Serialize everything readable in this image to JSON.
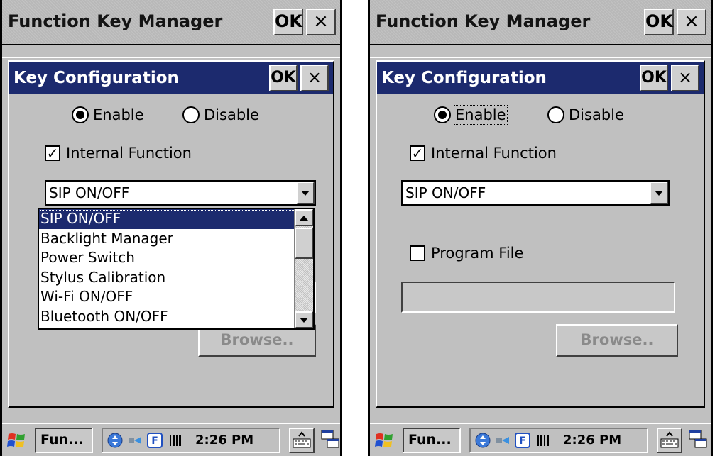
{
  "left": {
    "app_title": "Function Key Manager",
    "ok_label": "OK",
    "close_label": "×",
    "dialog": {
      "title": "Key Configuration",
      "ok_label": "OK",
      "close_label": "×",
      "enable_label": "Enable",
      "disable_label": "Disable",
      "enable_selected": true,
      "internal_function_label": "Internal Function",
      "internal_function_checked": true,
      "combo_value": "SIP ON/OFF",
      "dropdown_items": [
        "SIP ON/OFF",
        "Backlight Manager",
        "Power Switch",
        "Stylus Calibration",
        "Wi-Fi ON/OFF",
        "Bluetooth ON/OFF"
      ],
      "dropdown_selected_index": 0,
      "browse_label": "Browse.."
    },
    "taskbar": {
      "task_label": "Fun...",
      "clock": "2:26 PM",
      "tray_f_label": "F"
    }
  },
  "right": {
    "app_title": "Function Key Manager",
    "ok_label": "OK",
    "close_label": "×",
    "dialog": {
      "title": "Key Configuration",
      "ok_label": "OK",
      "close_label": "×",
      "enable_label": "Enable",
      "disable_label": "Disable",
      "enable_selected": true,
      "internal_function_label": "Internal Function",
      "internal_function_checked": true,
      "combo_value": "SIP ON/OFF",
      "program_file_label": "Program File",
      "program_file_checked": false,
      "program_file_value": "",
      "browse_label": "Browse.."
    },
    "taskbar": {
      "task_label": "Fun...",
      "clock": "2:26 PM",
      "tray_f_label": "F"
    }
  },
  "colors": {
    "dialog_title_bg": "#1c2a6e",
    "selection_bg": "#1c2a6e",
    "window_bg": "#c0c0c0"
  }
}
